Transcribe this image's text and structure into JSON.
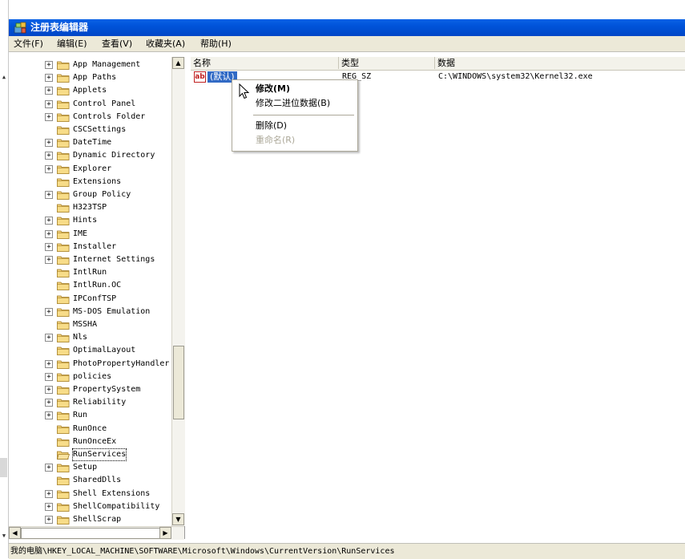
{
  "window": {
    "title": "注册表编辑器",
    "icon": "regedit-icon"
  },
  "menu": [
    "文件(F)",
    "编辑(E)",
    "查看(V)",
    "收藏夹(A)",
    "帮助(H)"
  ],
  "tree": {
    "items": [
      {
        "label": "App Management",
        "expandable": true
      },
      {
        "label": "App Paths",
        "expandable": true
      },
      {
        "label": "Applets",
        "expandable": true
      },
      {
        "label": "Control Panel",
        "expandable": true
      },
      {
        "label": "Controls Folder",
        "expandable": true
      },
      {
        "label": "CSCSettings",
        "expandable": false
      },
      {
        "label": "DateTime",
        "expandable": true
      },
      {
        "label": "Dynamic Directory",
        "expandable": true
      },
      {
        "label": "Explorer",
        "expandable": true
      },
      {
        "label": "Extensions",
        "expandable": false
      },
      {
        "label": "Group Policy",
        "expandable": true
      },
      {
        "label": "H323TSP",
        "expandable": false
      },
      {
        "label": "Hints",
        "expandable": true
      },
      {
        "label": "IME",
        "expandable": true
      },
      {
        "label": "Installer",
        "expandable": true
      },
      {
        "label": "Internet Settings",
        "expandable": true
      },
      {
        "label": "IntlRun",
        "expandable": false
      },
      {
        "label": "IntlRun.OC",
        "expandable": false
      },
      {
        "label": "IPConfTSP",
        "expandable": false
      },
      {
        "label": "MS-DOS Emulation",
        "expandable": true
      },
      {
        "label": "MSSHA",
        "expandable": false
      },
      {
        "label": "Nls",
        "expandable": true
      },
      {
        "label": "OptimalLayout",
        "expandable": false
      },
      {
        "label": "PhotoPropertyHandler",
        "expandable": true
      },
      {
        "label": "policies",
        "expandable": true
      },
      {
        "label": "PropertySystem",
        "expandable": true
      },
      {
        "label": "Reliability",
        "expandable": true
      },
      {
        "label": "Run",
        "expandable": true
      },
      {
        "label": "RunOnce",
        "expandable": false
      },
      {
        "label": "RunOnceEx",
        "expandable": false
      },
      {
        "label": "RunServices",
        "expandable": false,
        "selected": true
      },
      {
        "label": "Setup",
        "expandable": true
      },
      {
        "label": "SharedDlls",
        "expandable": false
      },
      {
        "label": "Shell Extensions",
        "expandable": true
      },
      {
        "label": "ShellCompatibility",
        "expandable": true
      },
      {
        "label": "ShellScrap",
        "expandable": true
      }
    ]
  },
  "list": {
    "headers": {
      "name": "名称",
      "type": "类型",
      "data": "数据"
    },
    "rows": [
      {
        "icon": "ab",
        "name": "(默认)",
        "type": "REG_SZ",
        "data": "C:\\WINDOWS\\system32\\Kernel32.exe"
      }
    ]
  },
  "context_menu": {
    "modify": "修改(M)",
    "modify_binary": "修改二进位数据(B)",
    "delete": "删除(D)",
    "rename": "重命名(R)"
  },
  "status": {
    "path": "我的电脑\\HKEY_LOCAL_MACHINE\\SOFTWARE\\Microsoft\\Windows\\CurrentVersion\\RunServices"
  },
  "colors": {
    "titlebar": "#0053d9",
    "selection": "#316ac5",
    "folder": "#f3d27a"
  }
}
